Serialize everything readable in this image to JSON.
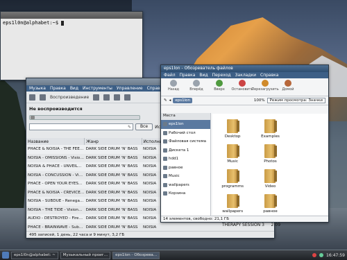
{
  "colors": {
    "accent": "#3d5f86",
    "selection": "#4e6a8a",
    "folder": "#e8c06d"
  },
  "terminal": {
    "title": "",
    "prompt": "eps1l0n@alphabet:~$"
  },
  "music": {
    "menu": [
      "Музыка",
      "Правка",
      "Вид",
      "Инструменты",
      "Управление",
      "Справка"
    ],
    "play_label": "Воспроизведение",
    "status": "Не воспроизводится",
    "search_button": "Все",
    "column_right": "Исполнитель",
    "columns": [
      "Название",
      "Жанр",
      "Исполни"
    ],
    "tracks": [
      {
        "title": "PHACE & NOISIA - THE FEE…",
        "genre": "DARK SIDE DRUM 'N' BASS",
        "artist": "NOISIA"
      },
      {
        "title": "NOISIA - OMISSIONS - Visio…",
        "genre": "DARK SIDE DRUM 'N' BASS",
        "artist": "NOISIA"
      },
      {
        "title": "NOISIA & PHACE - UNVEIL…",
        "genre": "DARK SIDE DRUM 'N' BASS",
        "artist": "NOISIA"
      },
      {
        "title": "NOISIA - CONCUSSION - Vi…",
        "genre": "DARK SIDE DRUM 'N' BASS",
        "artist": "NOISIA"
      },
      {
        "title": "PHACE - OPEN YOUR EYES…",
        "genre": "DARK SIDE DRUM 'N' BASS",
        "artist": "NOISIA"
      },
      {
        "title": "PHACE & NOISIA - CREVICE…",
        "genre": "DARK SIDE DRUM 'N' BASS",
        "artist": "NOISIA"
      },
      {
        "title": "NOISIA - SUBDUE - Renega…",
        "genre": "DARK SIDE DRUM 'N' BASS",
        "artist": "NOISIA"
      },
      {
        "title": "NOISIA - THE TIDE - Vision…",
        "genre": "DARK SIDE DRUM 'N' BASS",
        "artist": "NOISIA"
      },
      {
        "title": "AUDIO - DESTROYED - Fire…",
        "genre": "DARK SIDE DRUM 'N' BASS",
        "artist": "NOISIA"
      },
      {
        "title": "PHACE - BRAINWAVE - Sub…",
        "genre": "DARK SIDE DRUM 'N' BASS",
        "artist": "NOISIA"
      }
    ],
    "extra_album": "THERAPY SESSION 3",
    "extra_time": "2:09",
    "statusbar": "495 записей, 1 день, 22 часа и 9 минут, 3,2 ГБ"
  },
  "fm": {
    "title": "eps1lon - Обозреватель файлов",
    "menu": [
      "Файл",
      "Правка",
      "Вид",
      "Переход",
      "Закладки",
      "Справка"
    ],
    "nav": [
      "Назад",
      "Вперёд",
      "Вверх",
      "Остановить",
      "Перезагрузить",
      "Домой"
    ],
    "crumb": "eps1lon",
    "zoom": "100%",
    "view": "Режим просмотра: Значки",
    "places_header": "Места",
    "places": [
      "eps1lon",
      "Рабочий стол",
      "Файловая система",
      "Дискета 1",
      "hdd1",
      "равное",
      "Music",
      "wallpapers",
      "Корзина"
    ],
    "items": [
      "Desktop",
      "Examples",
      "",
      "Music",
      "Photos",
      "",
      "programms",
      "Video",
      "",
      "wallpapers",
      "равное"
    ],
    "statusbar": "14 элементов, свободно: 21,1 ГБ"
  },
  "panel": {
    "tasks": [
      "eps1l0n@alphabet: ~",
      "Музыкальный проиг…",
      "eps1lon - Обозрева…"
    ],
    "clock": "16:47:59"
  }
}
